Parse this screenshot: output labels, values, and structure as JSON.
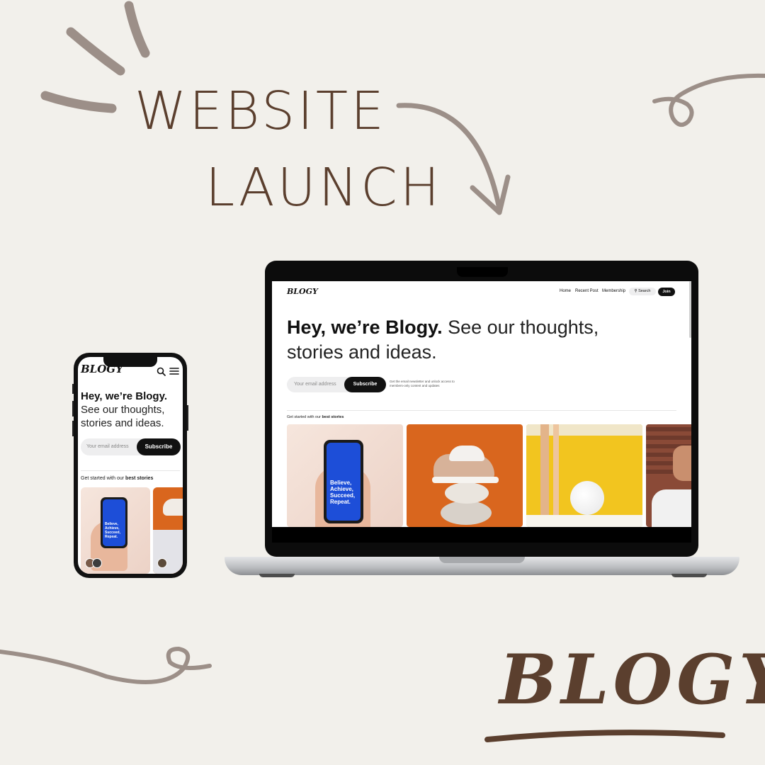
{
  "headline": {
    "line1": "WEBSITE",
    "line2": "LAUNCH"
  },
  "brand_wordmark": "BLOGY",
  "site": {
    "logo": "BLOGY",
    "nav": {
      "home": "Home",
      "recent": "Recent Post",
      "membership": "Membership",
      "search": "Search",
      "join": "Join"
    },
    "hero_bold": "Hey, we’re Blogy.",
    "hero_rest": "See our thoughts, stories and ideas.",
    "hero_rest_line1": "See our thoughts,",
    "hero_rest_line2": "stories and ideas.",
    "email_placeholder": "Your email address",
    "subscribe": "Subscribe",
    "newsletter_note": "Get the email newsletter and unlock access to members-only content and updates",
    "stories_prefix": "Get started with our",
    "stories_bold": "best stories",
    "card_phone_text": "Believe, Achieve, Succeed, Repeat."
  },
  "colors": {
    "background": "#f2f0eb",
    "accent_brown": "#5b3f2e",
    "doodle": "#9c8f88",
    "card_blue": "#1d4ed8",
    "card_orange": "#d9661e",
    "card_yellow": "#f2c51f"
  },
  "icons": [
    "search-icon",
    "menu-icon",
    "arrow-icon"
  ]
}
